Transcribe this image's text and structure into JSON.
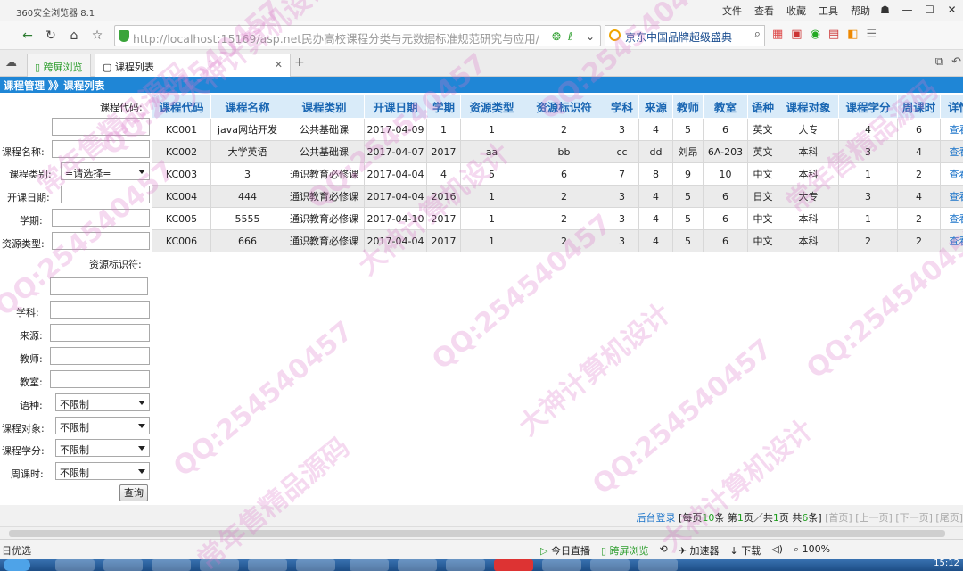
{
  "browser": {
    "title": "360安全浏览器 8.1",
    "menus": [
      "文件",
      "查看",
      "收藏",
      "工具",
      "帮助"
    ],
    "url": "http://localhost:15169/asp.net民办高校课程分类与元数据标准规范研究与应用/",
    "search_text": "京东中国品牌超级盛典",
    "tabs": [
      {
        "label": "跨屏浏览"
      },
      {
        "label": "课程列表"
      }
    ]
  },
  "page": {
    "breadcrumb": "课程管理 》》课程列表"
  },
  "filters": {
    "course_code": "课程代码:",
    "course_name": "课程名称:",
    "course_type": "课程类别:",
    "course_type_value": "=请选择=",
    "start_date": "开课日期:",
    "term": "学期:",
    "resource_type": "资源类型:",
    "resource_id": "资源标识符:",
    "subject": "学科:",
    "source": "来源:",
    "teacher": "教师:",
    "classroom": "教室:",
    "language": "语种:",
    "language_value": "不限制",
    "audience": "课程对象:",
    "audience_value": "不限制",
    "credits": "课程学分:",
    "credits_value": "不限制",
    "weekly_hours": "周课时:",
    "weekly_hours_value": "不限制",
    "query_button": "查询"
  },
  "table": {
    "headers": [
      "课程代码",
      "课程名称",
      "课程类别",
      "开课日期",
      "学期",
      "资源类型",
      "资源标识符",
      "学科",
      "来源",
      "教师",
      "教室",
      "语种",
      "课程对象",
      "课程学分",
      "周课时",
      "详情"
    ],
    "rows": [
      [
        "KC001",
        "java网站开发",
        "公共基础课",
        "2017-04-09",
        "1",
        "1",
        "2",
        "3",
        "4",
        "5",
        "6",
        "英文",
        "大专",
        "4",
        "6",
        "查看"
      ],
      [
        "KC002",
        "大学英语",
        "公共基础课",
        "2017-04-07",
        "2017",
        "aa",
        "bb",
        "cc",
        "dd",
        "刘昂",
        "6A-203",
        "英文",
        "本科",
        "3",
        "4",
        "查看"
      ],
      [
        "KC003",
        "3",
        "通识教育必修课",
        "2017-04-04",
        "4",
        "5",
        "6",
        "7",
        "8",
        "9",
        "10",
        "中文",
        "本科",
        "1",
        "2",
        "查看"
      ],
      [
        "KC004",
        "444",
        "通识教育必修课",
        "2017-04-04",
        "2016",
        "1",
        "2",
        "3",
        "4",
        "5",
        "6",
        "日文",
        "大专",
        "3",
        "4",
        "查看"
      ],
      [
        "KC005",
        "5555",
        "通识教育必修课",
        "2017-04-10",
        "2017",
        "1",
        "2",
        "3",
        "4",
        "5",
        "6",
        "中文",
        "本科",
        "1",
        "2",
        "查看"
      ],
      [
        "KC006",
        "666",
        "通识教育必修课",
        "2017-04-04",
        "2017",
        "1",
        "2",
        "3",
        "4",
        "5",
        "6",
        "中文",
        "本科",
        "2",
        "2",
        "查看"
      ]
    ]
  },
  "pager": {
    "admin_login": "后台登录",
    "per_page_prefix": "[每页",
    "per_page_num": "10",
    "per_page_suffix": "条 第",
    "current_page": "1",
    "of_total_prefix": "页／共",
    "total_pages": "1",
    "total_suffix": "页 共",
    "total_records": "6",
    "records_suffix": "条]",
    "first": "[首页]",
    "prev": "[上一页]",
    "next": "[下一页]",
    "last": "[尾页]"
  },
  "statusbar": {
    "left": "日优选",
    "items": [
      "今日直播",
      "跨屏浏览",
      "加速器",
      "下载",
      "100%"
    ]
  },
  "taskbar": {
    "clock": "15:12"
  },
  "watermarks": [
    "QQ:254540457",
    "常年售精品源码",
    "大神计算机设计"
  ]
}
